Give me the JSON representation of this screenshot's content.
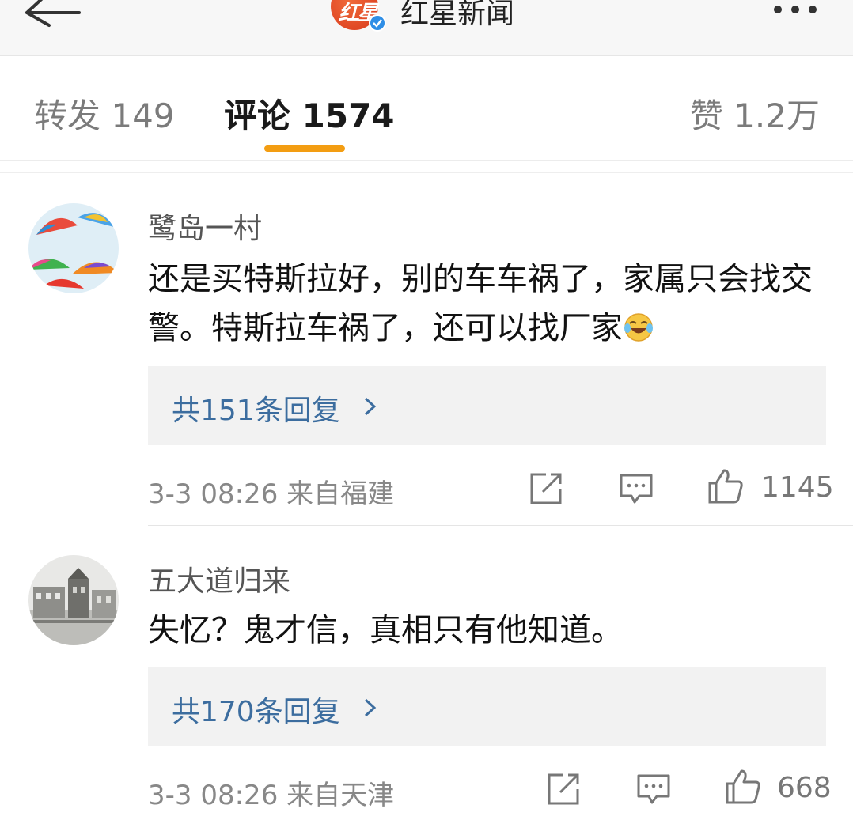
{
  "header": {
    "logo_text": "红星",
    "account_name": "红星新闻",
    "back_icon": "arrow-left-icon",
    "more_icon": "more-dots-icon"
  },
  "tabs": {
    "repost": "转发 149",
    "comments": "评论 1574",
    "likes": "赞 1.2万",
    "active_color": "#f39d12"
  },
  "comments": [
    {
      "username": "鹭岛一村",
      "text": "还是买特斯拉好，别的车车祸了，家属只会找交警。特斯拉车祸了，还可以找厂家",
      "emoji": "laugh-cry-icon",
      "replies": "共151条回复",
      "time_location": "3-3 08:26 来自福建",
      "likes": "1145"
    },
    {
      "username": "五大道归来",
      "text": "失忆？鬼才信，真相只有他知道。",
      "replies": "共170条回复",
      "time_location": "3-3 08:26 来自天津",
      "likes": "668"
    }
  ],
  "colors": {
    "link": "#3c6d9f",
    "reply_bg": "#f2f2f2",
    "verified": "#2f8ee6"
  }
}
